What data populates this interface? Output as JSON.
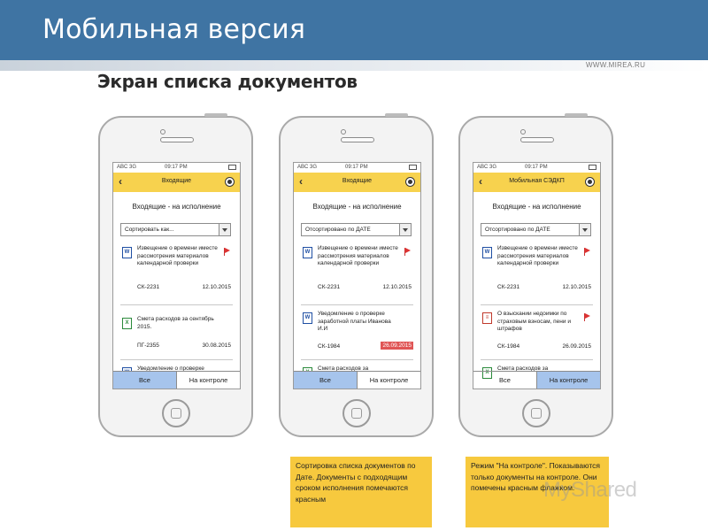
{
  "header": {
    "title": "Мобильная версия",
    "url": "WWW.MIREA.RU",
    "subtitle": "Экран списка документов"
  },
  "colors": {
    "header": "#3f74a3",
    "appbar": "#f7d24e",
    "tab_active": "#a6c4ec",
    "note": "#f7c93e",
    "overdue": "#e05555"
  },
  "phones": [
    {
      "status": {
        "carrier": "ABC 3G",
        "time": "09:17 PM"
      },
      "appbar_title": "Входящие",
      "list_title": "Входящие - на исполнение",
      "sort_label": "Сортировать как...",
      "items": [
        {
          "icon": "word-doc-icon",
          "glyph": "W",
          "text": "Извещение о времени иместе рассмотрения материалов календарной проверки",
          "flag": true,
          "number": "СК-2231",
          "date": "12.10.2015",
          "overdue": false
        },
        {
          "icon": "excel-doc-icon",
          "glyph": "X",
          "text": "Смета расходов за сентябрь 2015.",
          "flag": false,
          "number": "ПГ-2355",
          "date": "30.08.2015",
          "overdue": false
        },
        {
          "icon": "word-doc-icon",
          "glyph": "W",
          "text": "Уведомление о проверке",
          "flag": false,
          "number": "",
          "date": "",
          "overdue": false
        }
      ],
      "tabs": {
        "all": "Все",
        "control": "На контроле",
        "active": "all"
      }
    },
    {
      "status": {
        "carrier": "ABC 3G",
        "time": "09:17 PM"
      },
      "appbar_title": "Входящие",
      "list_title": "Входящие - на исполнение",
      "sort_label": "Отсортировано по ДАТЕ",
      "items": [
        {
          "icon": "word-doc-icon",
          "glyph": "W",
          "text": "Извещение о времени иместе рассмотрения материалов календарной проверки",
          "flag": true,
          "number": "СК-2231",
          "date": "12.10.2015",
          "overdue": false
        },
        {
          "icon": "word-doc-icon",
          "glyph": "W",
          "text": "Уведомление о проверке заработной платы Иванова И.И",
          "flag": false,
          "number": "СК-1984",
          "date": "26.09.2015",
          "overdue": true
        },
        {
          "icon": "excel-doc-icon",
          "glyph": "X",
          "text": "Смета расходов за",
          "flag": false,
          "number": "",
          "date": "",
          "overdue": false
        }
      ],
      "tabs": {
        "all": "Все",
        "control": "На контроле",
        "active": "all"
      }
    },
    {
      "status": {
        "carrier": "ABC 3G",
        "time": "09:17 PM"
      },
      "appbar_title": "Мобильная СЭДКП",
      "list_title": "Входящие - на исполнение",
      "sort_label": "Отсортировано по ДАТЕ",
      "items": [
        {
          "icon": "word-doc-icon",
          "glyph": "W",
          "text": "Извещение о времени иместе рассмотрения материалов календарной проверки",
          "flag": true,
          "number": "СК-2231",
          "date": "12.10.2015",
          "overdue": false
        },
        {
          "icon": "pdf-doc-icon",
          "glyph": "≡",
          "text": "О взыскании недоимки по страховым взносам, пени и штрафов",
          "flag": true,
          "number": "СК-1984",
          "date": "26.09.2015",
          "overdue": false
        },
        {
          "icon": "excel-doc-icon",
          "glyph": "X",
          "text": "Смета расходов за",
          "flag": false,
          "number": "",
          "date": "",
          "overdue": false
        }
      ],
      "tabs": {
        "all": "Все",
        "control": "На контроле",
        "active": "control"
      }
    }
  ],
  "notes": [
    "Сортировка списка документов по Дате. Документы с подходящим сроком исполнения помечаются красным",
    "Режим \"На контроле\". Показываются только документы на контроле. Они помечены красным флажком."
  ],
  "watermark": "MyShared"
}
